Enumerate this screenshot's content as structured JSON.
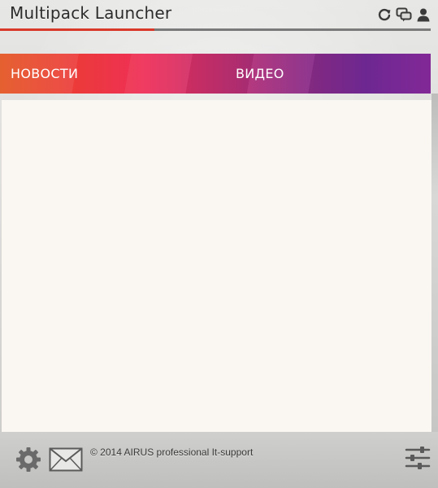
{
  "window": {
    "title": "Multipack Launcher"
  },
  "titlebar_icons": [
    {
      "name": "refresh-icon"
    },
    {
      "name": "chat-icon"
    },
    {
      "name": "user-icon"
    }
  ],
  "tabs": [
    {
      "label": "НОВОСТИ"
    },
    {
      "label": "ВИДЕО"
    }
  ],
  "footer": {
    "copyright": "© 2014 AIRUS professional It-support",
    "icons": [
      "gear-icon",
      "mail-icon",
      "sliders-icon"
    ]
  },
  "colors": {
    "accent": "#d9382a",
    "banner_start": "#e3531f",
    "banner_mid": "#ee2f58",
    "banner_end": "#74299a",
    "content_bg": "#faf6f1"
  }
}
